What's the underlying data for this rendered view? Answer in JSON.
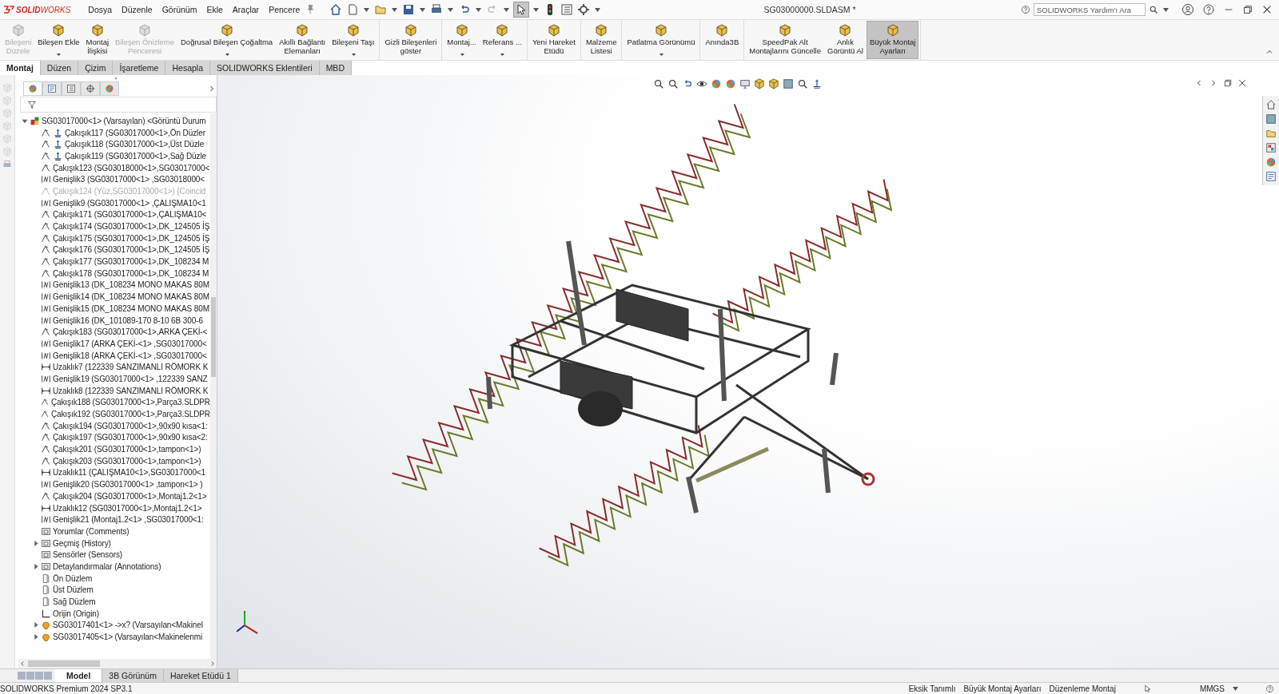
{
  "title_bar": {
    "logo": "**SOLID**WORKS",
    "menus": [
      "Dosya",
      "Düzenle",
      "Görünüm",
      "Ekle",
      "Araçlar",
      "Pencere"
    ],
    "title": "SG03000000.SLDASM *",
    "search": {
      "placeholder": "SOLIDWORKS Yardım'ı Ara"
    }
  },
  "command_manager": {
    "groups": [
      [
        {
          "label": "Bileşeni\nDüzele",
          "disabled": true,
          "selected": false,
          "dropdown": false
        },
        {
          "label": "Bileşen Ekle",
          "disabled": false,
          "selected": false,
          "dropdown": true
        },
        {
          "label": "Montaj\nİlişkisi",
          "disabled": false,
          "selected": false,
          "dropdown": false
        },
        {
          "label": "Bileşen Önizleme\nPenceresi",
          "disabled": true,
          "selected": false,
          "dropdown": false
        },
        {
          "label": "Doğrusal Bileşen Çoğaltma",
          "disabled": false,
          "selected": false,
          "dropdown": true
        },
        {
          "label": "Akıllı Bağlantı\nElemanları",
          "disabled": false,
          "selected": false,
          "dropdown": false
        },
        {
          "label": "Bileşeni Taşı",
          "disabled": false,
          "selected": false,
          "dropdown": true
        }
      ],
      [
        {
          "label": "Gizli Bileşenleri\ngöster",
          "disabled": false,
          "selected": false,
          "dropdown": false
        }
      ],
      [
        {
          "label": "Montaj...",
          "disabled": false,
          "selected": false,
          "dropdown": true
        },
        {
          "label": "Referans ...",
          "disabled": false,
          "selected": false,
          "dropdown": true
        }
      ],
      [
        {
          "label": "Yeni Hareket\nEtüdü",
          "disabled": false,
          "selected": false,
          "dropdown": false
        }
      ],
      [
        {
          "label": "Malzeme\nListesi",
          "disabled": false,
          "selected": false,
          "dropdown": false
        }
      ],
      [
        {
          "label": "Patlatma Görünümü",
          "disabled": false,
          "selected": false,
          "dropdown": true
        }
      ],
      [
        {
          "label": "Anında3B",
          "disabled": false,
          "selected": false,
          "dropdown": false
        }
      ],
      [
        {
          "label": "SpeedPak Alt\nMontajlarını Güncelle",
          "disabled": false,
          "selected": false,
          "dropdown": false
        },
        {
          "label": "Anlık\nGörüntü Al",
          "disabled": false,
          "selected": false,
          "dropdown": false
        },
        {
          "label": "Büyük Montaj\nAyarları",
          "disabled": false,
          "selected": true,
          "dropdown": false
        }
      ]
    ]
  },
  "command_tabs": [
    {
      "label": "Montaj",
      "selected": true
    },
    {
      "label": "Düzen",
      "selected": false
    },
    {
      "label": "Çizim",
      "selected": false
    },
    {
      "label": "İşaretleme",
      "selected": false
    },
    {
      "label": "Hesapla",
      "selected": false
    },
    {
      "label": "SOLIDWORKS Eklentileri",
      "selected": false
    },
    {
      "label": "MBD",
      "selected": false
    }
  ],
  "feature_tree": {
    "items": [
      {
        "kind": "assembly",
        "text": "SG03017000<1> (Varsayılan) <Görüntü Durum",
        "disabled": false,
        "expanded": true,
        "children": [
          {
            "kind": "grounded",
            "text": "Çakışık117 (SG03017000<1>,Ön Düzler",
            "disabled": false
          },
          {
            "kind": "grounded",
            "text": "Çakışık118 (SG03017000<1>,Üst Düzle",
            "disabled": false
          },
          {
            "kind": "grounded",
            "text": "Çakışık119 (SG03017000<1>,Sağ Düzle",
            "disabled": false
          },
          {
            "kind": "coincident",
            "text": "Çakışık123 (SG03018000<1>,SG03017000<",
            "disabled": false
          },
          {
            "kind": "width",
            "text": "Genişlik3 (SG03017000<1> ,SG03018000<",
            "disabled": false
          },
          {
            "kind": "coincident",
            "text": "Çakışık124 (Yüz,SG03017000<1>) {Coincid",
            "disabled": true
          },
          {
            "kind": "width",
            "text": "Genişlik9 (SG03017000<1> ,ÇALIŞMA10<1",
            "disabled": false
          },
          {
            "kind": "coincident",
            "text": "Çakışık171 (SG03017000<1>,ÇALIŞMA10<",
            "disabled": false
          },
          {
            "kind": "coincident",
            "text": "Çakışık174 (SG03017000<1>,DK_124505 İŞ",
            "disabled": false
          },
          {
            "kind": "coincident",
            "text": "Çakışık175 (SG03017000<1>,DK_124505 İŞ",
            "disabled": false
          },
          {
            "kind": "coincident",
            "text": "Çakışık176 (SG03017000<1>,DK_124505 İŞ",
            "disabled": false
          },
          {
            "kind": "coincident",
            "text": "Çakışık177 (SG03017000<1>,DK_108234 M",
            "disabled": false
          },
          {
            "kind": "coincident",
            "text": "Çakışık178 (SG03017000<1>,DK_108234 M",
            "disabled": false
          },
          {
            "kind": "width",
            "text": "Genişlik13 (DK_108234 MONO MAKAS 80M",
            "disabled": false
          },
          {
            "kind": "width",
            "text": "Genişlik14 (DK_108234 MONO MAKAS 80M",
            "disabled": false
          },
          {
            "kind": "width",
            "text": "Genişlik15 (DK_108234 MONO MAKAS 80M",
            "disabled": false
          },
          {
            "kind": "width",
            "text": "Genişlik16 (DK_101089-170 8-10 6B 300-6",
            "disabled": false
          },
          {
            "kind": "coincident",
            "text": "Çakışık183 (SG03017000<1>,ARKA ÇEKİ-<",
            "disabled": false
          },
          {
            "kind": "width",
            "text": "Genişlik17 (ARKA ÇEKİ-<1> ,SG03017000<",
            "disabled": false
          },
          {
            "kind": "width",
            "text": "Genişlik18 (ARKA ÇEKİ-<1> ,SG03017000<",
            "disabled": false
          },
          {
            "kind": "distance",
            "text": "Uzaklık7 (122339 SANZIMANLI RÖMORK K",
            "disabled": false
          },
          {
            "kind": "width",
            "text": "Genişlik19 (SG03017000<1> ,122339 SANZ",
            "disabled": false
          },
          {
            "kind": "distance",
            "text": "Uzaklık8 (122339 SANZIMANLI RÖMORK K",
            "disabled": false
          },
          {
            "kind": "coincident",
            "text": "Çakışık188 (SG03017000<1>,Parça3.SLDPR",
            "disabled": false
          },
          {
            "kind": "coincident",
            "text": "Çakışık192 (SG03017000<1>,Parça3.SLDPR",
            "disabled": false
          },
          {
            "kind": "coincident",
            "text": "Çakışık194 (SG03017000<1>,90x90 kısa<1:",
            "disabled": false
          },
          {
            "kind": "coincident",
            "text": "Çakışık197 (SG03017000<1>,90x90 kısa<2:",
            "disabled": false
          },
          {
            "kind": "coincident",
            "text": "Çakışık201 (SG03017000<1>,tampon<1>)",
            "disabled": false
          },
          {
            "kind": "coincident",
            "text": "Çakışık203 (SG03017000<1>,tampon<1>)",
            "disabled": false
          },
          {
            "kind": "distance",
            "text": "Uzaklık11 (ÇALIŞMA10<1>,SG03017000<1",
            "disabled": false
          },
          {
            "kind": "width",
            "text": "Genişlik20 (SG03017000<1> ,tampon<1> )",
            "disabled": false
          },
          {
            "kind": "coincident",
            "text": "Çakışık204 (SG03017000<1>,Montaj1.2<1>",
            "disabled": false
          },
          {
            "kind": "distance",
            "text": "Uzaklık12 (SG03017000<1>,Montaj1.2<1>",
            "disabled": false
          },
          {
            "kind": "width",
            "text": "Genişlik21 (Montaj1.2<1> ,SG03017000<1:",
            "disabled": false
          },
          {
            "kind": "folder",
            "text": "Yorumlar (Comments)",
            "disabled": false
          },
          {
            "kind": "folder",
            "text": "Geçmiş (History)",
            "disabled": false,
            "expanded": false
          },
          {
            "kind": "folder",
            "text": "Sensörler (Sensors)",
            "disabled": false
          },
          {
            "kind": "folder",
            "text": "Detaylandırmalar (Annotations)",
            "disabled": false,
            "expanded": false
          },
          {
            "kind": "plane",
            "text": "Ön Düzlem",
            "disabled": false
          },
          {
            "kind": "plane",
            "text": "Üst Düzlem",
            "disabled": false
          },
          {
            "kind": "plane",
            "text": "Sağ Düzlem",
            "disabled": false
          },
          {
            "kind": "origin",
            "text": "Orijin (Origin)",
            "disabled": false
          },
          {
            "kind": "part",
            "text": "SG03017401<1> ->x? (Varsayılan<Makinel",
            "disabled": false,
            "expanded": false
          },
          {
            "kind": "part",
            "text": "SG03017405<1> (Varsayılan<Makinelenmi",
            "disabled": false,
            "expanded": false
          }
        ]
      }
    ]
  },
  "bottom_tabs": [
    {
      "label": "Model",
      "selected": true
    },
    {
      "label": "3B Görünüm",
      "selected": false
    },
    {
      "label": "Hareket Etüdü 1",
      "selected": false
    }
  ],
  "status_bar": {
    "product": "SOLIDWORKS Premium 2024 SP3.1",
    "items": [
      "Eksik Tanımlı",
      "Büyük Montaj Ayarları",
      "Düzenleme Montaj"
    ],
    "units": "MMGS"
  }
}
